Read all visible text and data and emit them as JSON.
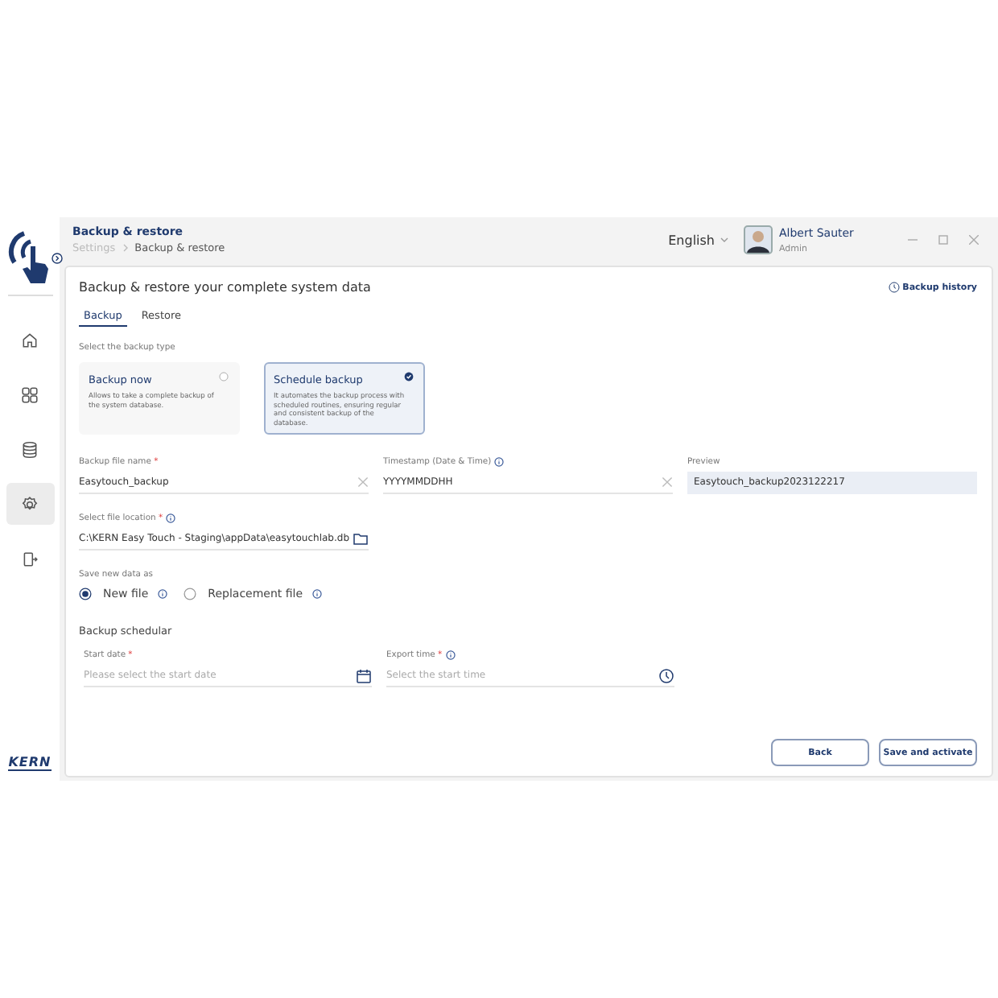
{
  "sidebar": {
    "logo": "KERN",
    "items": [
      {
        "kind": "home",
        "selected": false
      },
      {
        "kind": "grid",
        "selected": false
      },
      {
        "kind": "database",
        "selected": false
      },
      {
        "kind": "settings",
        "selected": true
      },
      {
        "kind": "logout",
        "selected": false
      }
    ]
  },
  "header": {
    "title": "Backup & restore",
    "breadcrumb": [
      "Settings",
      "Backup & restore"
    ],
    "language": "English",
    "user": {
      "name": "Albert Sauter",
      "role": "Admin"
    }
  },
  "card": {
    "title": "Backup & restore your complete system data",
    "history": "Backup history",
    "tabs": [
      {
        "label": "Backup",
        "selected": true
      },
      {
        "label": "Restore",
        "selected": false
      }
    ],
    "type_label": "Select the backup type",
    "types": [
      {
        "title": "Backup now",
        "description": "Allows to take a complete backup of the system database.",
        "selected": false
      },
      {
        "title": "Schedule backup",
        "description": "It automates the backup process with scheduled routines, ensuring regular and consistent backup of the database.",
        "selected": true
      }
    ],
    "fields": [
      {
        "kind": "text",
        "label": "Backup file name",
        "mark": "*",
        "info": false,
        "value": "Easytouch_backup"
      },
      {
        "kind": "text",
        "label": "Timestamp (Date & Time)",
        "info": true,
        "value": "YYYYMMDDHH"
      },
      {
        "kind": "preview",
        "label": "Preview",
        "info": false,
        "value": "Easytouch_backup2023122217"
      }
    ],
    "location": {
      "kind": "folder",
      "label": "Select file location",
      "mark": "*",
      "info": true,
      "value": "C:\\KERN Easy Touch - Staging\\appData\\easytouchlab.db"
    },
    "save_as": {
      "label": "Save new data as",
      "options": [
        {
          "label": "New file",
          "selected": true
        },
        {
          "label": "Replacement file",
          "selected": false
        }
      ]
    },
    "scheduler": {
      "title": "Backup schedular",
      "fields": [
        {
          "kind": "date",
          "label": "Start date",
          "mark": "*",
          "info": false,
          "placeholder": "Please select the start date"
        },
        {
          "kind": "time",
          "label": "Export time",
          "mark": "*",
          "info": true,
          "placeholder": "Select the start time"
        }
      ]
    },
    "buttons": [
      "Back",
      "Save and activate"
    ]
  }
}
